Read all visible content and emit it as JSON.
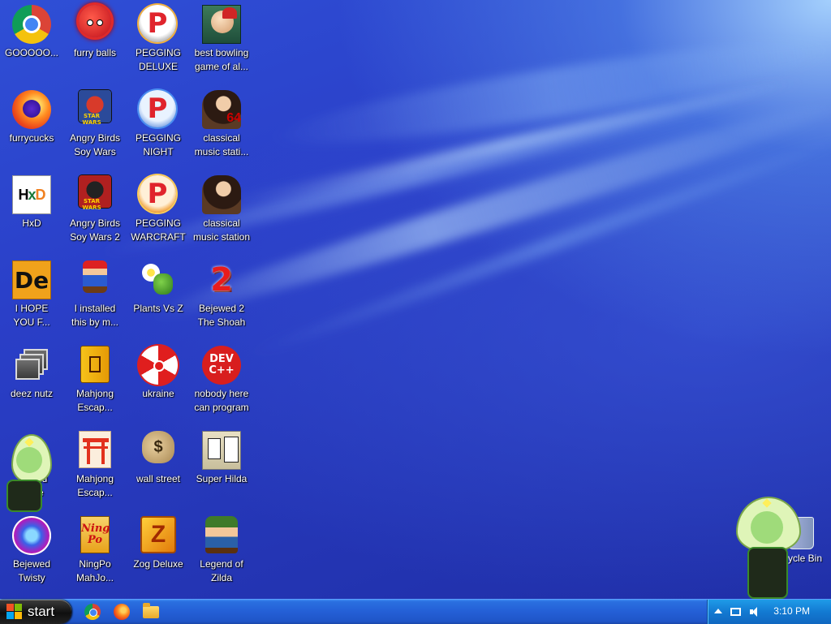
{
  "desktop": {
    "icons": [
      {
        "label": "GOOOOO...",
        "icon": "chrome-icon"
      },
      {
        "label": "furry balls",
        "icon": "furry-balls-icon"
      },
      {
        "label": "PEGGING\nDELUXE",
        "icon": "pegging-icon"
      },
      {
        "label": "best bowling\ngame of al...",
        "icon": "bowling-icon"
      },
      {
        "label": "furrycucks",
        "icon": "firefox-icon"
      },
      {
        "label": "Angry Birds\nSoy Wars",
        "icon": "angry-birds-icon"
      },
      {
        "label": "PEGGING\nNIGHT",
        "icon": "pegging-night-icon"
      },
      {
        "label": "classical\nmusic stati...",
        "icon": "classical-music-icon"
      },
      {
        "label": "HxD",
        "icon": "hxd-icon"
      },
      {
        "label": "Angry Birds\nSoy Wars 2",
        "icon": "angry-birds-2-icon"
      },
      {
        "label": "PEGGING\nWARCRAFT",
        "icon": "pegging-warcraft-icon"
      },
      {
        "label": "classical\nmusic station",
        "icon": "classical-music-icon"
      },
      {
        "label": "I HOPE\nYOU F...",
        "icon": "de-icon"
      },
      {
        "label": "I installed\nthis by m...",
        "icon": "mario-icon"
      },
      {
        "label": "Plants Vs Z",
        "icon": "plants-icon"
      },
      {
        "label": "Bejewed 2\nThe Shoah",
        "icon": "bejeweled-2-icon"
      },
      {
        "label": "deez nutz",
        "icon": "windows-icon"
      },
      {
        "label": "Mahjong\nEscap...",
        "icon": "mahjong-icon"
      },
      {
        "label": "ukraine",
        "icon": "radiation-icon"
      },
      {
        "label": "nobody here\ncan program",
        "icon": "devcpp-icon"
      },
      {
        "label": "...ewed\n...uxe",
        "icon": "bejeweled-deluxe-icon"
      },
      {
        "label": "Mahjong\nEscap...",
        "icon": "torii-icon"
      },
      {
        "label": "wall street",
        "icon": "money-bag-icon"
      },
      {
        "label": "Super Hilda",
        "icon": "super-hilda-icon"
      },
      {
        "label": "Bejewed\nTwisty",
        "icon": "bejeweled-twist-icon"
      },
      {
        "label": "NingPo\nMahJo...",
        "icon": "ningpo-icon"
      },
      {
        "label": "Zog Deluxe",
        "icon": "zog-icon"
      },
      {
        "label": "Legend of\nZilda",
        "icon": "zilda-icon"
      }
    ],
    "icon_text": {
      "pegging": "P",
      "angry_sub": "STAR WARS",
      "lady_num": "64",
      "hxd_h": "H",
      "hxd_x": "x",
      "hxd_d": "D",
      "de": "De",
      "bj2": "2",
      "dev_top": "DEV",
      "dev_bottom": "C++",
      "bag": "$",
      "ningpo_top": "Ning",
      "ningpo_bottom": "Po",
      "zog": "Z"
    },
    "recycle_bin": {
      "label": "...ycle Bin",
      "icon": "recycle-bin-icon"
    }
  },
  "taskbar": {
    "start_label": "start",
    "quick_launch": [
      "chrome-icon",
      "firefox-icon",
      "folder-icon"
    ],
    "tray": {
      "clock": "3:10 PM"
    }
  },
  "colors": {
    "taskbar": "#245fd6",
    "tray": "#137ad2",
    "start": "#1a1a1a"
  }
}
